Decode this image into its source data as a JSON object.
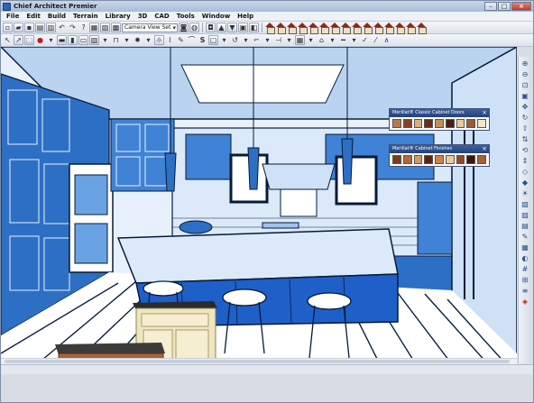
{
  "window": {
    "title": "Chief Architect Premier",
    "buttons": {
      "minimize": "–",
      "maximize": "□",
      "close": "×"
    }
  },
  "menu": [
    "File",
    "Edit",
    "Build",
    "Terrain",
    "Library",
    "3D",
    "CAD",
    "Tools",
    "Window",
    "Help"
  ],
  "toolbar": {
    "view_select": "Camera View Set"
  },
  "palettes": [
    {
      "title": "Merillat® Classic Cabinet Doors",
      "swatches": [
        "#b97a4b",
        "#8a3f22",
        "#d9b07a",
        "#6b2b18",
        "#c58b55",
        "#4a1d12",
        "#e8c99a",
        "#9a5a35",
        "#f2e6c8"
      ]
    },
    {
      "title": "Merillat® Cabinet Finishes",
      "swatches": [
        "#7a3b1f",
        "#b06a3d",
        "#d49a61",
        "#5a2613",
        "#c98452",
        "#e9c9a0",
        "#8e4a2a",
        "#3c160b",
        "#a95f35"
      ]
    }
  ],
  "colors": {
    "accent": "#1f5fc8",
    "title_bar": "#a9bcd9",
    "sketch_blue": "#2e7bd8"
  },
  "icons": {
    "app": "chief-architect-logo-icon",
    "select": "pointer-icon",
    "house_views": "house-icon"
  }
}
